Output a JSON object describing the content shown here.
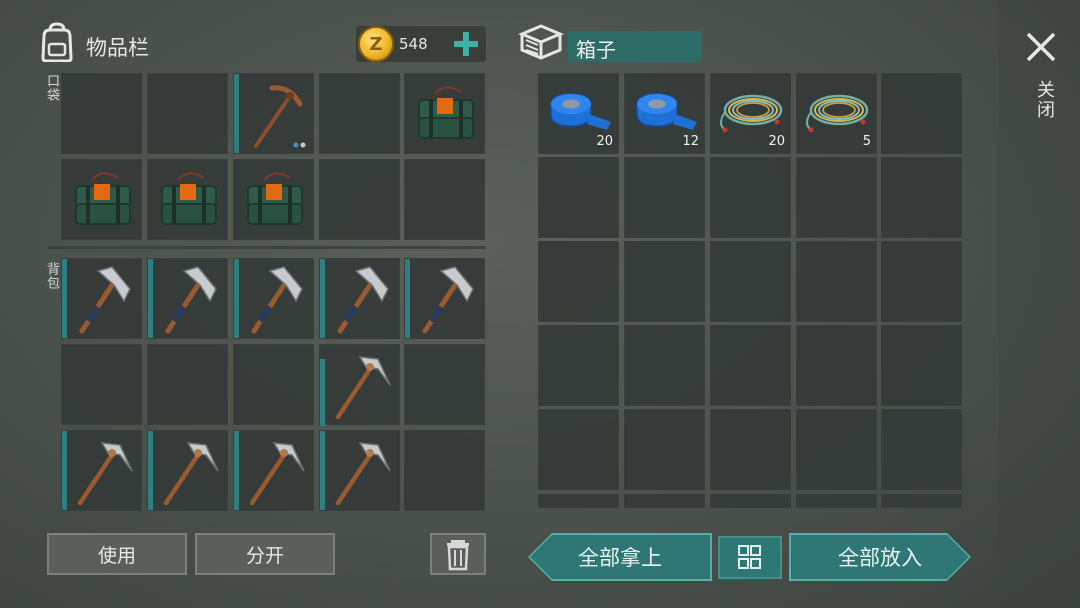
{
  "header": {
    "inventory_title": "物品栏",
    "coin_symbol": "Z",
    "coin_count": "548",
    "container_title": "箱子",
    "close_label": "关闭"
  },
  "sections": {
    "pocket_label": "口袋",
    "backpack_label": "背包"
  },
  "container_slots": [
    {
      "item": "blue-tape",
      "qty": "20"
    },
    {
      "item": "blue-tape",
      "qty": "12"
    },
    {
      "item": "wire-coil",
      "qty": "20"
    },
    {
      "item": "wire-coil",
      "qty": "5"
    }
  ],
  "buttons": {
    "use": "使用",
    "split": "分开",
    "take_all": "全部拿上",
    "put_all": "全部放入"
  },
  "colors": {
    "accent_teal": "#2e7774",
    "durability_bar": "#2f7e82",
    "slot_bg": "#343a37",
    "coin_gold": "#f0b72a"
  }
}
